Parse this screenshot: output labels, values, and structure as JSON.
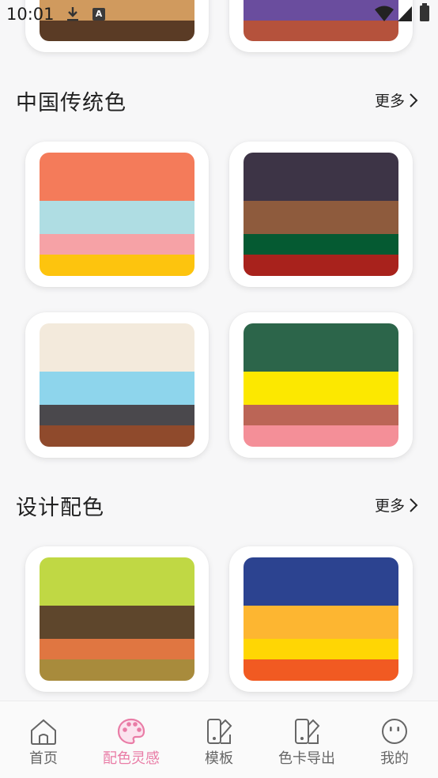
{
  "status_bar": {
    "time": "10:01",
    "notification_letter": "A"
  },
  "top_partial": {
    "left_palette": [
      "#d09a5e",
      "#5a3b25"
    ],
    "right_palette": [
      "#6a4d9e",
      "#b5523c"
    ]
  },
  "sections": [
    {
      "title": "中国传统色",
      "more_label": "更多",
      "palettes": [
        [
          "#f47b5a",
          "#afdde3",
          "#f6a2a6",
          "#fdc40e"
        ],
        [
          "#3d3446",
          "#8e5b3d",
          "#055a32",
          "#a8221c"
        ],
        [
          "#f3eadc",
          "#8ed5ec",
          "#4a484c",
          "#8f4a2c"
        ],
        [
          "#2c654a",
          "#fce800",
          "#bb6556",
          "#f48f98"
        ]
      ]
    },
    {
      "title": "设计配色",
      "more_label": "更多",
      "palettes": [
        [
          "#c0d844",
          "#5e462c",
          "#e07641",
          "#a88b3c"
        ],
        [
          "#2c4390",
          "#fdb631",
          "#ffd604",
          "#f15a22"
        ]
      ]
    }
  ],
  "bottom_nav": {
    "items": [
      {
        "label": "首页",
        "icon": "home-icon",
        "active": false
      },
      {
        "label": "配色灵感",
        "icon": "palette-icon",
        "active": true
      },
      {
        "label": "模板",
        "icon": "template-icon",
        "active": false
      },
      {
        "label": "色卡导出",
        "icon": "color-card-export-icon",
        "active": false
      },
      {
        "label": "我的",
        "icon": "profile-icon",
        "active": false
      }
    ],
    "active_color": "#e97ca6",
    "inactive_color": "#666666"
  }
}
